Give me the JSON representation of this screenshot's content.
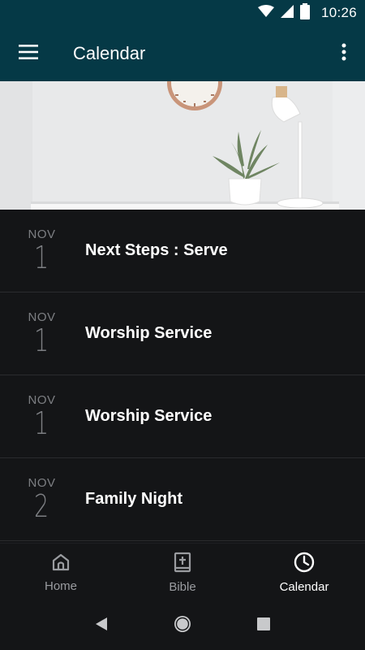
{
  "status_bar": {
    "time": "10:26"
  },
  "app_bar": {
    "title": "Calendar"
  },
  "events": [
    {
      "month": "NOV",
      "day": "1",
      "title": "Next Steps : Serve"
    },
    {
      "month": "NOV",
      "day": "1",
      "title": "Worship Service"
    },
    {
      "month": "NOV",
      "day": "1",
      "title": "Worship Service"
    },
    {
      "month": "NOV",
      "day": "2",
      "title": "Family Night"
    }
  ],
  "bottom_nav": {
    "items": [
      {
        "label": "Home",
        "icon": "home-icon",
        "active": false
      },
      {
        "label": "Bible",
        "icon": "bible-icon",
        "active": false
      },
      {
        "label": "Calendar",
        "icon": "clock-icon",
        "active": true
      }
    ]
  },
  "colors": {
    "app_bar": "#053946",
    "background": "#141517",
    "muted_text": "#7d7f83"
  }
}
